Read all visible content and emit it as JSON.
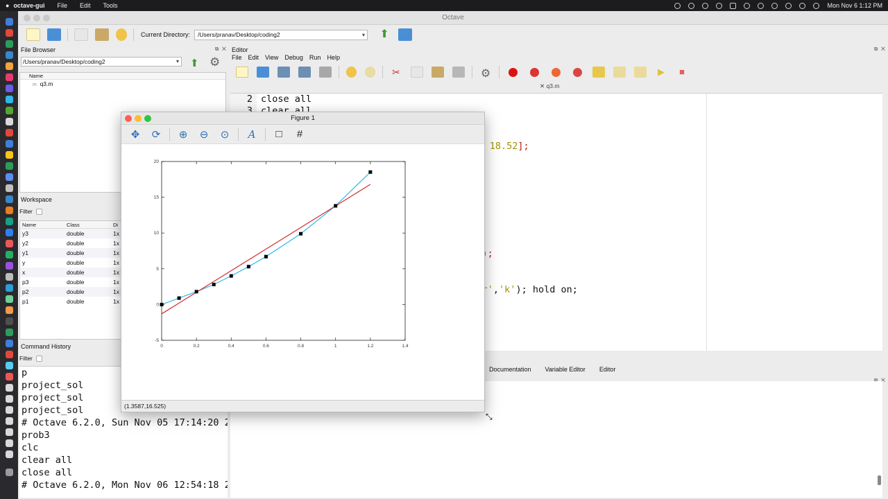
{
  "menubar": {
    "app_name": "octave-gui",
    "items": [
      "File",
      "Edit",
      "Tools"
    ],
    "clock": "Mon Nov 6  1:12 PM"
  },
  "window": {
    "title": "Octave",
    "current_directory_label": "Current Directory:",
    "current_directory": "/Users/pranav/Desktop/coding2"
  },
  "file_browser": {
    "title": "File Browser",
    "path": "/Users/pranav/Desktop/coding2",
    "column_name": "Name",
    "files": [
      {
        "icon": "m-file-icon",
        "name": "q3.m"
      }
    ]
  },
  "workspace": {
    "title": "Workspace",
    "filter_label": "Filter",
    "columns": [
      "Name",
      "Class",
      "Di"
    ],
    "rows": [
      {
        "name": "y3",
        "class": "double",
        "dim": "1x"
      },
      {
        "name": "y2",
        "class": "double",
        "dim": "1x"
      },
      {
        "name": "y1",
        "class": "double",
        "dim": "1x"
      },
      {
        "name": "y",
        "class": "double",
        "dim": "1x"
      },
      {
        "name": "x",
        "class": "double",
        "dim": "1x"
      },
      {
        "name": "p3",
        "class": "double",
        "dim": "1x"
      },
      {
        "name": "p2",
        "class": "double",
        "dim": "1x"
      },
      {
        "name": "p1",
        "class": "double",
        "dim": "1x"
      }
    ]
  },
  "command_history": {
    "title": "Command History",
    "filter_label": "Filter",
    "entries": [
      "p",
      "project_sol",
      "project_sol",
      "project_sol",
      "# Octave 6.2.0, Sun Nov 05 17:14:20 2",
      "prob3",
      "clc",
      "clear all",
      "close all",
      "# Octave 6.2.0, Mon Nov 06 12:54:18 2"
    ]
  },
  "editor": {
    "title": "Editor",
    "menu": [
      "File",
      "Edit",
      "View",
      "Debug",
      "Run",
      "Help"
    ],
    "tab_label": "q3.m",
    "line_numbers": [
      "2",
      "3"
    ],
    "lines": [
      {
        "segments": [
          {
            "text": "close all",
            "style": "plain"
          }
        ]
      },
      {
        "segments": [
          {
            "text": "clear all",
            "style": "plain"
          }
        ]
      },
      {
        "segments": [
          {
            "text": ".2",
            "style": "str"
          },
          {
            "text": "];",
            "style": "kw"
          }
        ]
      },
      {
        "segments": [
          {
            "text": " 13.8 18.52",
            "style": "str"
          },
          {
            "text": "];",
            "style": "kw"
          }
        ]
      },
      {
        "segments": [
          {
            "text": "p3(",
            "style": "plain"
          },
          {
            "text": "4",
            "style": "str"
          },
          {
            "text": ");",
            "style": "kw"
          }
        ]
      },
      {
        "segments": [
          {
            "text": "ecolor'",
            "style": "str"
          },
          {
            "text": ",",
            "style": "plain"
          },
          {
            "text": "'k'",
            "style": "str"
          },
          {
            "text": "); hold on;",
            "style": "plain"
          }
        ]
      }
    ]
  },
  "bottom_tabs": [
    "Documentation",
    "Variable Editor",
    "Editor"
  ],
  "figure": {
    "title": "Figure 1",
    "status": "(1.3587,16.525)",
    "toolbar": [
      {
        "name": "pan-icon",
        "glyph": "✥"
      },
      {
        "name": "rotate-icon",
        "glyph": "⟳"
      },
      {
        "name": "zoom-in-icon",
        "glyph": "⊕"
      },
      {
        "name": "zoom-out-icon",
        "glyph": "⊖"
      },
      {
        "name": "zoom-reset-icon",
        "glyph": "⊙"
      },
      {
        "name": "text-icon",
        "glyph": "A"
      },
      {
        "name": "axes-box-icon",
        "glyph": "□"
      },
      {
        "name": "grid-icon",
        "glyph": "#"
      }
    ]
  },
  "chart_data": {
    "type": "line",
    "title": "",
    "xlabel": "",
    "ylabel": "",
    "xlim": [
      0,
      1.4
    ],
    "ylim": [
      -5,
      20
    ],
    "x_ticks": [
      "0",
      "0.2",
      "0.4",
      "0.6",
      "0.8",
      "1",
      "1.2",
      "1.4"
    ],
    "y_ticks": [
      "-5",
      "0",
      "5",
      "10",
      "15",
      "20"
    ],
    "grid": false,
    "series": [
      {
        "style": "markers",
        "color": "#000000",
        "x": [
          0,
          0.1,
          0.2,
          0.3,
          0.4,
          0.5,
          0.6,
          0.8,
          1.0,
          1.2
        ],
        "y": [
          0,
          0.9,
          1.8,
          2.8,
          4.0,
          5.3,
          6.7,
          9.9,
          13.8,
          18.52
        ]
      },
      {
        "style": "line",
        "color": "#2fb7e8",
        "x": [
          0,
          0.1,
          0.2,
          0.3,
          0.4,
          0.5,
          0.6,
          0.8,
          1.0,
          1.2
        ],
        "y": [
          0,
          0.9,
          1.8,
          2.8,
          4.0,
          5.3,
          6.7,
          9.9,
          13.8,
          18.52
        ]
      },
      {
        "style": "line",
        "color": "#d62728",
        "x": [
          0,
          1.2
        ],
        "y": [
          -1.3,
          16.8
        ]
      }
    ]
  }
}
